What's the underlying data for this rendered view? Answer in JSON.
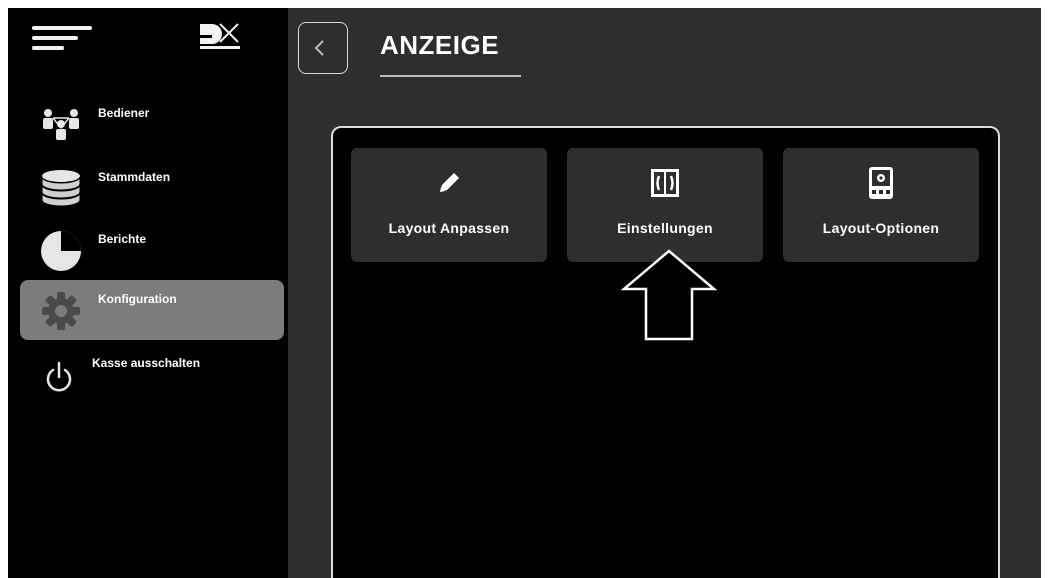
{
  "sidebar": {
    "items": [
      {
        "label": "Bediener",
        "icon": "users-icon"
      },
      {
        "label": "Stammdaten",
        "icon": "database-icon"
      },
      {
        "label": "Berichte",
        "icon": "pie-chart-icon"
      },
      {
        "label": "Konfiguration",
        "icon": "gear-icon",
        "active": true
      },
      {
        "label": "Kasse ausschalten",
        "icon": "power-icon"
      }
    ]
  },
  "header": {
    "title": "ANZEIGE"
  },
  "tiles": [
    {
      "label": "Layout Anpassen",
      "icon": "pencil-icon"
    },
    {
      "label": "Einstellungen",
      "icon": "settings-panel-icon"
    },
    {
      "label": "Layout-Optionen",
      "icon": "terminal-icon"
    }
  ],
  "colors": {
    "background": "#000000",
    "main": "#2e2e2e",
    "active_item": "#7c7c7c",
    "text": "#ffffff"
  }
}
